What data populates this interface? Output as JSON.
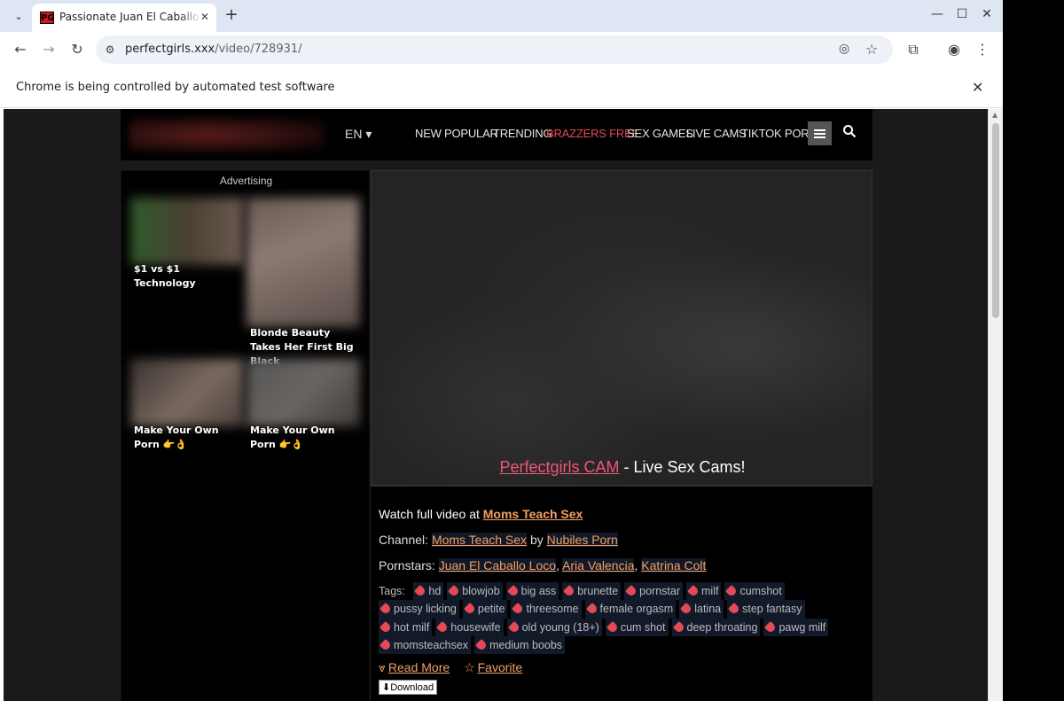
{
  "browser": {
    "tab_title": "Passionate Juan El Caballo Loco",
    "favicon_text": "PG",
    "url_host": "perfectgirls.xxx",
    "url_path": "/video/728931/",
    "infobar_text": "Chrome is being controlled by automated test software"
  },
  "header": {
    "language": "EN ▾",
    "nav": [
      {
        "label": "NEW"
      },
      {
        "label": "POPULAR"
      },
      {
        "label": "TRENDING"
      },
      {
        "label": "BRAZZERS FREE"
      },
      {
        "label": "SEX GAMES"
      },
      {
        "label": "LIVE CAMS"
      },
      {
        "label": "TIKTOK PORN"
      }
    ],
    "accent_color": "#e44a56"
  },
  "ads": {
    "label": "Advertising",
    "items": [
      {
        "title": "$1 vs $1 Technology"
      },
      {
        "title": "Blonde Beauty Takes Her First Big Black"
      },
      {
        "title": "Make Your Own Porn 👉👌"
      },
      {
        "title": "Make Your Own Porn 👉👌"
      }
    ]
  },
  "video": {
    "cam_link": "Perfectgirls CAM",
    "cam_suffix": " - Live Sex Cams!"
  },
  "info": {
    "watch_prefix": "Watch full video at ",
    "watch_link": "Moms Teach Sex",
    "channel_label": "Channel: ",
    "channel_name": "Moms Teach Sex",
    "channel_by": " by ",
    "channel_network": "Nubiles Porn",
    "pornstars_label": "Pornstars: ",
    "pornstars": [
      "Juan El Caballo Loco",
      "Aria Valencia",
      "Katrina Colt"
    ],
    "tags_label": "Tags:",
    "tags": [
      "hd",
      "blowjob",
      "big ass",
      "brunette",
      "pornstar",
      "milf",
      "cumshot",
      "pussy licking",
      "petite",
      "threesome",
      "female orgasm",
      "latina",
      "step fantasy",
      "hot milf",
      "housewife",
      "old young (18+)",
      "cum shot",
      "deep throating",
      "pawg milf",
      "momsteachsex",
      "medium boobs"
    ],
    "read_more": "Read More",
    "favorite": "Favorite",
    "download": "⬇Download"
  }
}
